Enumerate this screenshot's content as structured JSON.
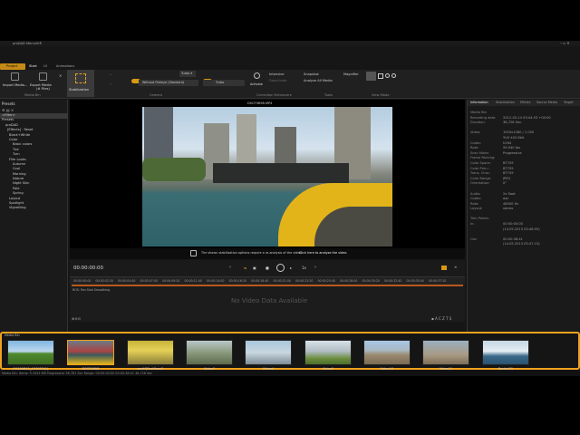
{
  "app": {
    "title": "proDAD Mercalli®"
  },
  "tabs": {
    "project": "Project",
    "start": "Start",
    "ui": "UI",
    "animations": "Animations"
  },
  "toolbar": {
    "import_media": "Import Media...",
    "export_media": "Export Media",
    "export_media_sub": "(# Files)",
    "media_bin_group": "Media Bin",
    "stabilization": "Stabilization",
    "smooth_movements": "Smooth movements",
    "turbo": "Turbo ▾",
    "without_fisheye": "Without Fisheye (Standard)",
    "camera_group": "Camera",
    "cmos_correction": "CMOS Correction",
    "cmos_turbo": "Turbo",
    "activate": "Activate",
    "intensive": "Intensive",
    "deactivate": "Deactivate",
    "correction_enhancers_group": "Correction Enhancers",
    "snapshot": "Snapshot",
    "analyze_all_media": "Analyze All Media",
    "tools_group": "Tools",
    "magnifier": "Magnifier",
    "view_mode_group": "View Mode"
  },
  "presets": {
    "header": "Presets",
    "tree": [
      "<Filter>",
      "Presets",
      "proDAD",
      "[Effects] · Reset",
      "Black+White",
      "Color",
      "Basic colors",
      "Tint",
      "Turn",
      "Film Looks",
      "Autumn",
      "Cool",
      "Morning",
      "Nature",
      "Night Skin",
      "Pale",
      "Spring",
      "Layout",
      "Spotlight",
      "Vignetting"
    ]
  },
  "video": {
    "filename": "DSCF9898.MP4",
    "notice": "The shown stabilization options require a re-analysis of the video.",
    "notice_link": "Click here to analyze the video",
    "timecode": "00:00:00:00",
    "speed": "1x",
    "no_data": "No Video Data Available",
    "track_label": "ROS: Pan Shot Smoothing",
    "ruler": [
      "00:00:00:00",
      "00:00:02:20",
      "00:00:04:40",
      "00:00:07:00",
      "00:00:09:20",
      "00:00:11:40",
      "00:00:14:00",
      "00:00:16:20",
      "00:00:18:40",
      "00:00:21:00",
      "00:00:23:20",
      "00:00:25:40",
      "00:00:28:00",
      "00:00:30:20",
      "00:00:32:40",
      "00:00:35:00",
      "00:00:37:20"
    ]
  },
  "info": {
    "tabs": [
      "Information",
      "Stabilization",
      "Effects",
      "Source Media",
      "Target"
    ],
    "rows": [
      {
        "k": "Media file:",
        "v": ""
      },
      {
        "k": "Recording date:",
        "v": "2012-05-14 03:44:53 +00:00"
      },
      {
        "k": "Duration:",
        "v": "38,728 Sec."
      },
      {
        "k": "",
        "v": ""
      },
      {
        "k": "Video:",
        "v": "1920x1080 / 1.000"
      },
      {
        "k": "",
        "v": "YUV 420 8bit"
      },
      {
        "k": "Codec:",
        "v": "h264"
      },
      {
        "k": "Rate:",
        "v": "59,940 fps"
      },
      {
        "k": "Scan Mode:",
        "v": "Progressive"
      },
      {
        "k": "Frame Packing:",
        "v": ""
      },
      {
        "k": "Color Space:",
        "v": "BT709"
      },
      {
        "k": "Color Prim.:",
        "v": "BT709"
      },
      {
        "k": "Trans. Char.:",
        "v": "BT709"
      },
      {
        "k": "Color Range:",
        "v": "JPEG"
      },
      {
        "k": "Orientation:",
        "v": "0°"
      },
      {
        "k": "",
        "v": ""
      },
      {
        "k": "Audio:",
        "v": "2x float"
      },
      {
        "k": "Codec:",
        "v": "aac"
      },
      {
        "k": "Rate:",
        "v": "48000 Hz"
      },
      {
        "k": "Layout:",
        "v": "stereo"
      },
      {
        "k": "",
        "v": ""
      },
      {
        "k": "Trim Points:",
        "v": ""
      },
      {
        "k": "In:",
        "v": "00:00:00:00"
      },
      {
        "k": "",
        "v": "(14.05.2013 03:48:55)"
      },
      {
        "k": "",
        "v": ""
      },
      {
        "k": "Out:",
        "v": "00:00:38:41"
      },
      {
        "k": "",
        "v": "(14.05.2013 03:47:13)"
      }
    ]
  },
  "mediabin": {
    "label": "Media Bin",
    "items": [
      "20130815_125227(1)",
      "DSCF9898",
      "sssHQFastSeed1",
      "Video3",
      "Video4",
      "Video5",
      "Video10",
      "Video11",
      "Bartek31"
    ]
  },
  "statusbar": {
    "text": "Media Bin:  Items: 9   2043 MB   Progressive   56,781 Sec   Range: 00:00:00:00 00:00:38:41   38,728 Sec"
  },
  "colors": {
    "accent": "#f0a21e",
    "panel": "#1d1d1d"
  }
}
